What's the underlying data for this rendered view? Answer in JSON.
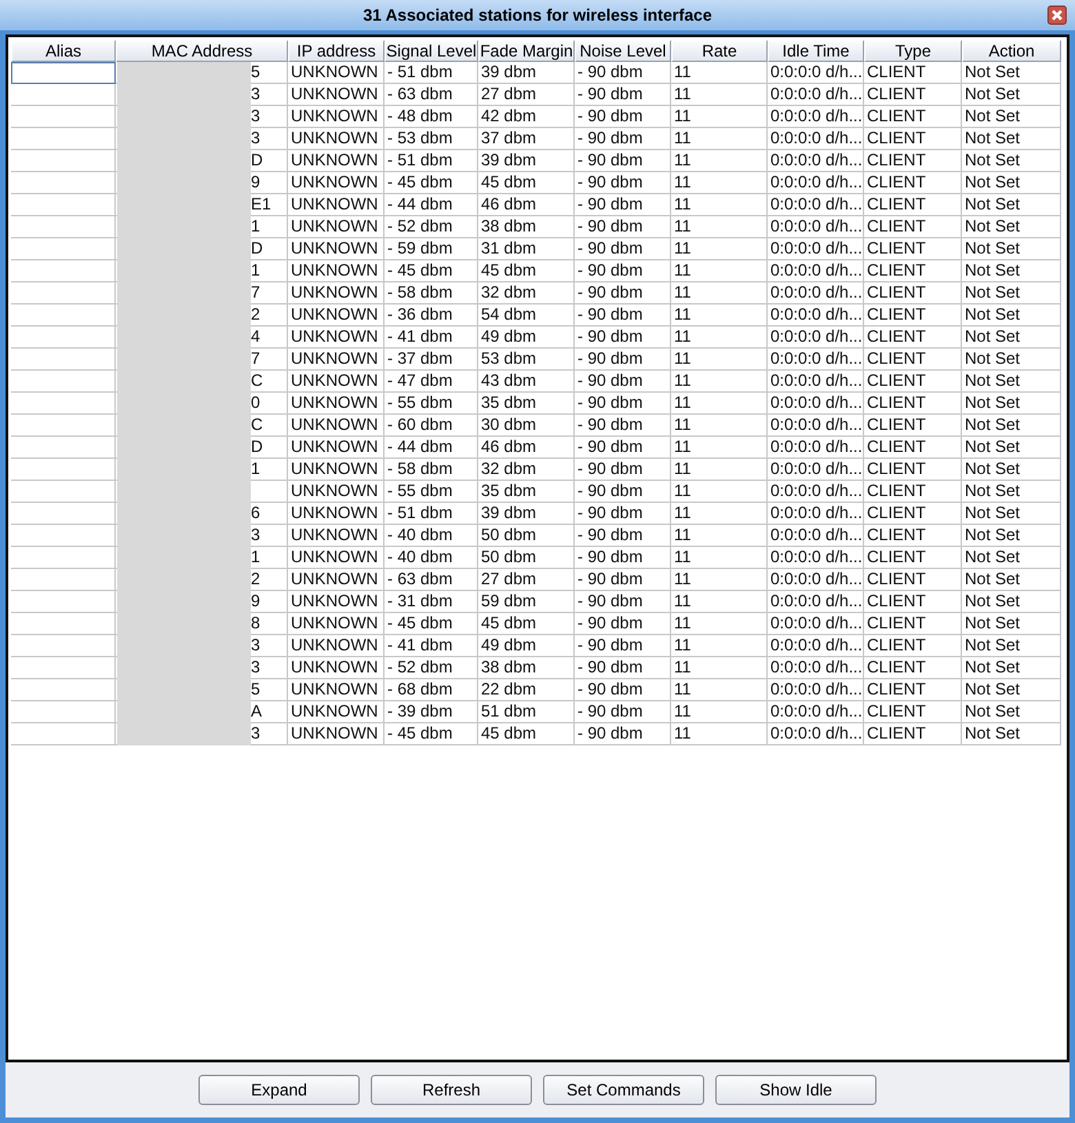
{
  "window": {
    "title": "31 Associated stations for wireless interface"
  },
  "table": {
    "columns": [
      "Alias",
      "MAC Address",
      "IP address",
      "Signal Level",
      "Fade Margin",
      "Noise Level",
      "Rate",
      "Idle Time",
      "Type",
      "Action"
    ],
    "rows": [
      {
        "selected": true,
        "mac": "5",
        "ip": "UNKNOWN",
        "signal": "- 51 dbm",
        "fade": "39 dbm",
        "noise": "- 90 dbm",
        "rate": "11",
        "idle": "0:0:0:0 d/h...",
        "type": "CLIENT",
        "action": "Not Set"
      },
      {
        "selected": false,
        "mac": "3",
        "ip": "UNKNOWN",
        "signal": "- 63 dbm",
        "fade": "27 dbm",
        "noise": "- 90 dbm",
        "rate": "11",
        "idle": "0:0:0:0 d/h...",
        "type": "CLIENT",
        "action": "Not Set"
      },
      {
        "selected": false,
        "mac": "3",
        "ip": "UNKNOWN",
        "signal": "- 48 dbm",
        "fade": "42 dbm",
        "noise": "- 90 dbm",
        "rate": "11",
        "idle": "0:0:0:0 d/h...",
        "type": "CLIENT",
        "action": "Not Set"
      },
      {
        "selected": false,
        "mac": "3",
        "ip": "UNKNOWN",
        "signal": "- 53 dbm",
        "fade": "37 dbm",
        "noise": "- 90 dbm",
        "rate": "11",
        "idle": "0:0:0:0 d/h...",
        "type": "CLIENT",
        "action": "Not Set"
      },
      {
        "selected": false,
        "mac": "D",
        "ip": "UNKNOWN",
        "signal": "- 51 dbm",
        "fade": "39 dbm",
        "noise": "- 90 dbm",
        "rate": "11",
        "idle": "0:0:0:0 d/h...",
        "type": "CLIENT",
        "action": "Not Set"
      },
      {
        "selected": false,
        "mac": "9",
        "ip": "UNKNOWN",
        "signal": "- 45 dbm",
        "fade": "45 dbm",
        "noise": "- 90 dbm",
        "rate": "11",
        "idle": "0:0:0:0 d/h...",
        "type": "CLIENT",
        "action": "Not Set"
      },
      {
        "selected": false,
        "mac": "E1",
        "ip": "UNKNOWN",
        "signal": "- 44 dbm",
        "fade": "46 dbm",
        "noise": "- 90 dbm",
        "rate": "11",
        "idle": "0:0:0:0 d/h...",
        "type": "CLIENT",
        "action": "Not Set"
      },
      {
        "selected": false,
        "mac": "1",
        "ip": "UNKNOWN",
        "signal": "- 52 dbm",
        "fade": "38 dbm",
        "noise": "- 90 dbm",
        "rate": "11",
        "idle": "0:0:0:0 d/h...",
        "type": "CLIENT",
        "action": "Not Set"
      },
      {
        "selected": false,
        "mac": "D",
        "ip": "UNKNOWN",
        "signal": "- 59 dbm",
        "fade": "31 dbm",
        "noise": "- 90 dbm",
        "rate": "11",
        "idle": "0:0:0:0 d/h...",
        "type": "CLIENT",
        "action": "Not Set"
      },
      {
        "selected": false,
        "mac": "1",
        "ip": "UNKNOWN",
        "signal": "- 45 dbm",
        "fade": "45 dbm",
        "noise": "- 90 dbm",
        "rate": "11",
        "idle": "0:0:0:0 d/h...",
        "type": "CLIENT",
        "action": "Not Set"
      },
      {
        "selected": false,
        "mac": "7",
        "ip": "UNKNOWN",
        "signal": "- 58 dbm",
        "fade": "32 dbm",
        "noise": "- 90 dbm",
        "rate": "11",
        "idle": "0:0:0:0 d/h...",
        "type": "CLIENT",
        "action": "Not Set"
      },
      {
        "selected": false,
        "mac": "2",
        "ip": "UNKNOWN",
        "signal": "- 36 dbm",
        "fade": "54 dbm",
        "noise": "- 90 dbm",
        "rate": "11",
        "idle": "0:0:0:0 d/h...",
        "type": "CLIENT",
        "action": "Not Set"
      },
      {
        "selected": false,
        "mac": "4",
        "ip": "UNKNOWN",
        "signal": "- 41 dbm",
        "fade": "49 dbm",
        "noise": "- 90 dbm",
        "rate": "11",
        "idle": "0:0:0:0 d/h...",
        "type": "CLIENT",
        "action": "Not Set"
      },
      {
        "selected": false,
        "mac": "7",
        "ip": "UNKNOWN",
        "signal": "- 37 dbm",
        "fade": "53 dbm",
        "noise": "- 90 dbm",
        "rate": "11",
        "idle": "0:0:0:0 d/h...",
        "type": "CLIENT",
        "action": "Not Set"
      },
      {
        "selected": false,
        "mac": "C",
        "ip": "UNKNOWN",
        "signal": "- 47 dbm",
        "fade": "43 dbm",
        "noise": "- 90 dbm",
        "rate": "11",
        "idle": "0:0:0:0 d/h...",
        "type": "CLIENT",
        "action": "Not Set"
      },
      {
        "selected": false,
        "mac": "0",
        "ip": "UNKNOWN",
        "signal": "- 55 dbm",
        "fade": "35 dbm",
        "noise": "- 90 dbm",
        "rate": "11",
        "idle": "0:0:0:0 d/h...",
        "type": "CLIENT",
        "action": "Not Set"
      },
      {
        "selected": false,
        "mac": "C",
        "ip": "UNKNOWN",
        "signal": "- 60 dbm",
        "fade": "30 dbm",
        "noise": "- 90 dbm",
        "rate": "11",
        "idle": "0:0:0:0 d/h...",
        "type": "CLIENT",
        "action": "Not Set"
      },
      {
        "selected": false,
        "mac": "D",
        "ip": "UNKNOWN",
        "signal": "- 44 dbm",
        "fade": "46 dbm",
        "noise": "- 90 dbm",
        "rate": "11",
        "idle": "0:0:0:0 d/h...",
        "type": "CLIENT",
        "action": "Not Set"
      },
      {
        "selected": false,
        "mac": "1",
        "ip": "UNKNOWN",
        "signal": "- 58 dbm",
        "fade": "32 dbm",
        "noise": "- 90 dbm",
        "rate": "11",
        "idle": "0:0:0:0 d/h...",
        "type": "CLIENT",
        "action": "Not Set"
      },
      {
        "selected": false,
        "ip": "UNKNOWN",
        "signal": "- 55 dbm",
        "fade": "35 dbm",
        "noise": "- 90 dbm",
        "rate": "11",
        "idle": "0:0:0:0 d/h...",
        "type": "CLIENT",
        "action": "Not Set"
      },
      {
        "selected": false,
        "mac": "6",
        "ip": "UNKNOWN",
        "signal": "- 51 dbm",
        "fade": "39 dbm",
        "noise": "- 90 dbm",
        "rate": "11",
        "idle": "0:0:0:0 d/h...",
        "type": "CLIENT",
        "action": "Not Set"
      },
      {
        "selected": false,
        "mac": "3",
        "ip": "UNKNOWN",
        "signal": "- 40 dbm",
        "fade": "50 dbm",
        "noise": "- 90 dbm",
        "rate": "11",
        "idle": "0:0:0:0 d/h...",
        "type": "CLIENT",
        "action": "Not Set"
      },
      {
        "selected": false,
        "mac": "1",
        "ip": "UNKNOWN",
        "signal": "- 40 dbm",
        "fade": "50 dbm",
        "noise": "- 90 dbm",
        "rate": "11",
        "idle": "0:0:0:0 d/h...",
        "type": "CLIENT",
        "action": "Not Set"
      },
      {
        "selected": false,
        "mac": "2",
        "ip": "UNKNOWN",
        "signal": "- 63 dbm",
        "fade": "27 dbm",
        "noise": "- 90 dbm",
        "rate": "11",
        "idle": "0:0:0:0 d/h...",
        "type": "CLIENT",
        "action": "Not Set"
      },
      {
        "selected": false,
        "mac": "9",
        "ip": "UNKNOWN",
        "signal": "- 31 dbm",
        "fade": "59 dbm",
        "noise": "- 90 dbm",
        "rate": "11",
        "idle": "0:0:0:0 d/h...",
        "type": "CLIENT",
        "action": "Not Set"
      },
      {
        "selected": false,
        "mac": "8",
        "ip": "UNKNOWN",
        "signal": "- 45 dbm",
        "fade": "45 dbm",
        "noise": "- 90 dbm",
        "rate": "11",
        "idle": "0:0:0:0 d/h...",
        "type": "CLIENT",
        "action": "Not Set"
      },
      {
        "selected": false,
        "mac": "3",
        "ip": "UNKNOWN",
        "signal": "- 41 dbm",
        "fade": "49 dbm",
        "noise": "- 90 dbm",
        "rate": "11",
        "idle": "0:0:0:0 d/h...",
        "type": "CLIENT",
        "action": "Not Set"
      },
      {
        "selected": false,
        "mac": "3",
        "ip": "UNKNOWN",
        "signal": "- 52 dbm",
        "fade": "38 dbm",
        "noise": "- 90 dbm",
        "rate": "11",
        "idle": "0:0:0:0 d/h...",
        "type": "CLIENT",
        "action": "Not Set"
      },
      {
        "selected": false,
        "mac": "5",
        "ip": "UNKNOWN",
        "signal": "- 68 dbm",
        "fade": "22 dbm",
        "noise": "- 90 dbm",
        "rate": "11",
        "idle": "0:0:0:0 d/h...",
        "type": "CLIENT",
        "action": "Not Set"
      },
      {
        "selected": false,
        "mac": "A",
        "ip": "UNKNOWN",
        "signal": "- 39 dbm",
        "fade": "51 dbm",
        "noise": "- 90 dbm",
        "rate": "11",
        "idle": "0:0:0:0 d/h...",
        "type": "CLIENT",
        "action": "Not Set"
      },
      {
        "selected": false,
        "mac": "3",
        "ip": "UNKNOWN",
        "signal": "- 45 dbm",
        "fade": "45 dbm",
        "noise": "- 90 dbm",
        "rate": "11",
        "idle": "0:0:0:0 d/h...",
        "type": "CLIENT",
        "action": "Not Set"
      }
    ]
  },
  "buttons": [
    "Expand",
    "Refresh",
    "Set Commands",
    "Show Idle"
  ]
}
